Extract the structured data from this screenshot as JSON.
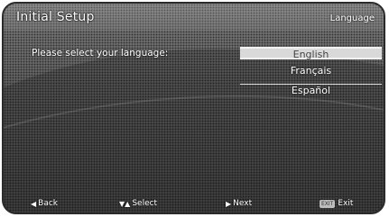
{
  "header": {
    "title": "Initial Setup",
    "section": "Language"
  },
  "main": {
    "prompt": "Please select your language:",
    "languages": [
      {
        "label": "English",
        "selected": true
      },
      {
        "label": "Français",
        "selected": false
      },
      {
        "label": "Español",
        "selected": false
      }
    ]
  },
  "footer": {
    "back_label": "Back",
    "select_label": "Select",
    "next_label": "Next",
    "exit_key": "EXIT",
    "exit_label": "Exit",
    "back_icon": "triangle-left-icon",
    "select_icon": "up-down-arrows-icon",
    "next_icon": "triangle-right-icon"
  }
}
